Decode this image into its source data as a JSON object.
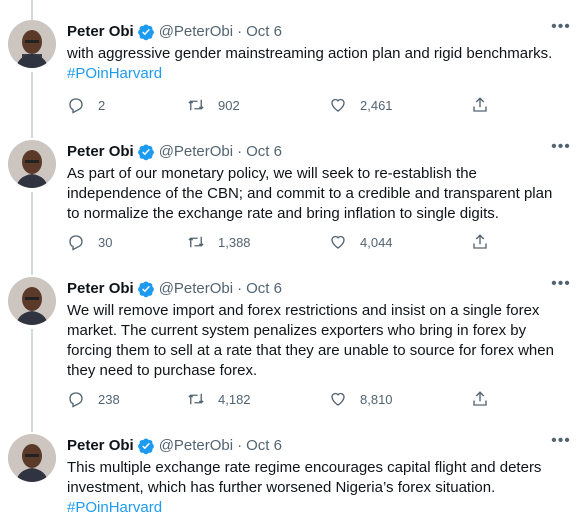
{
  "tweets": [
    {
      "name": "Peter Obi",
      "handle": "@PeterObi",
      "separator": "·",
      "date": "Oct 6",
      "text": "with aggressive gender mainstreaming action plan and rigid benchmarks.",
      "hashtag": "#POinHarvard",
      "replies": "2",
      "retweets": "902",
      "likes": "2,461"
    },
    {
      "name": "Peter Obi",
      "handle": "@PeterObi",
      "separator": "·",
      "date": "Oct 6",
      "text": "As part of our monetary policy, we will seek to re-establish the independence of the CBN; and commit to a credible and transparent plan to normalize the exchange rate and bring inflation to single digits.",
      "hashtag": "",
      "replies": "30",
      "retweets": "1,388",
      "likes": "4,044"
    },
    {
      "name": "Peter Obi",
      "handle": "@PeterObi",
      "separator": "·",
      "date": "Oct 6",
      "text": "We will remove import and forex restrictions and insist on a single forex market.  The current system penalizes exporters who bring in forex by forcing them to sell at a rate that they are unable to source for forex when they need to purchase forex.",
      "hashtag": "",
      "replies": "238",
      "retweets": "4,182",
      "likes": "8,810"
    },
    {
      "name": "Peter Obi",
      "handle": "@PeterObi",
      "separator": "·",
      "date": "Oct 6",
      "text": "This multiple exchange rate regime encourages capital flight and deters investment, which has further worsened Nigeria’s forex situation.",
      "hashtag": "#POinHarvard",
      "replies": "",
      "retweets": "",
      "likes": ""
    }
  ],
  "icons": {
    "more": "more-horizontal-icon",
    "verified": "verified-badge-icon",
    "reply": "reply-icon",
    "retweet": "retweet-icon",
    "like": "heart-icon",
    "share": "share-icon"
  },
  "colors": {
    "accent": "#1d9bf0",
    "secondary_text": "#536471",
    "thread_line": "#cfd9de"
  }
}
